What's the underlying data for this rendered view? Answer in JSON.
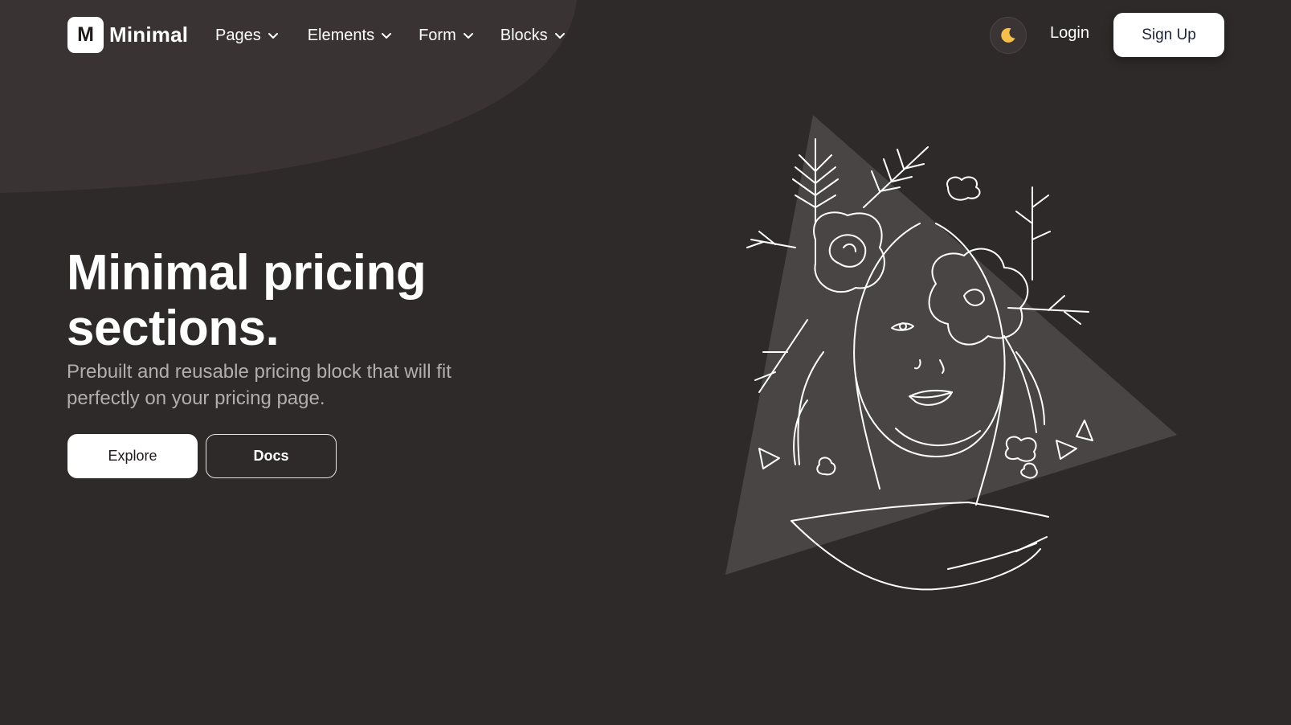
{
  "brand": {
    "logo_letter": "M",
    "name": "Minimal"
  },
  "nav": {
    "items": [
      {
        "label": "Pages"
      },
      {
        "label": "Elements"
      },
      {
        "label": "Form"
      },
      {
        "label": "Blocks"
      }
    ],
    "theme_icon": "moon-icon",
    "login_label": "Login",
    "signup_label": "Sign Up"
  },
  "hero": {
    "title_line1": "Minimal pricing",
    "title_line2": "sections.",
    "subtitle": "Prebuilt and reusable pricing block that will fit perfectly on your pricing page.",
    "explore_label": "Explore",
    "docs_label": "Docs"
  },
  "colors": {
    "background": "#2f2a2a",
    "blob": "#393333",
    "illustration_triangle": "#4a4545",
    "moon": "#f5c04a",
    "button_light": "#ffffff"
  }
}
